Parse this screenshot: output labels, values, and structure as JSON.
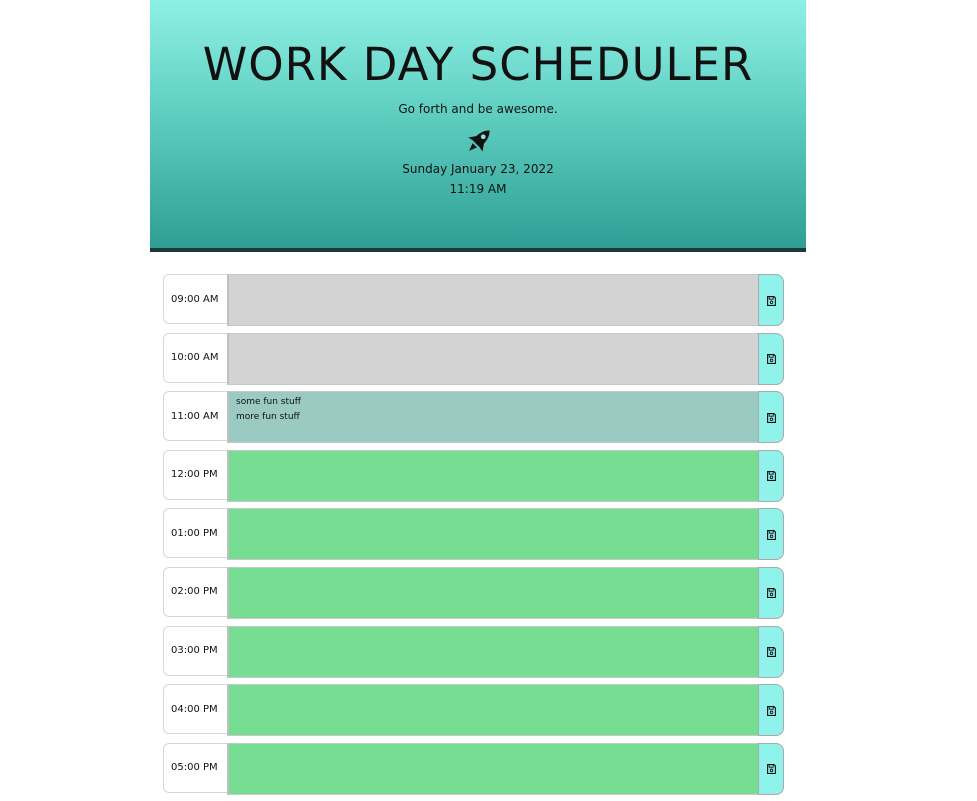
{
  "header": {
    "title": "WORK DAY SCHEDULER",
    "lead": "Go forth and be awesome.",
    "icon": "rocket-icon",
    "current_date": "Sunday January 23, 2022",
    "current_time": "11:19 AM"
  },
  "colors": {
    "past": "#d3d3d3",
    "present": "#9acac2",
    "future": "#77dd92",
    "save_button": "#8ff3ec",
    "header_top": "#8ff0e4",
    "header_bottom": "#2f9f95"
  },
  "schedule": [
    {
      "hour": "09:00 AM",
      "text": "",
      "state": "past"
    },
    {
      "hour": "10:00 AM",
      "text": "",
      "state": "past"
    },
    {
      "hour": "11:00 AM",
      "text": "some fun stuff\nmore fun stuff",
      "state": "present"
    },
    {
      "hour": "12:00 PM",
      "text": "",
      "state": "future"
    },
    {
      "hour": "01:00 PM",
      "text": "",
      "state": "future"
    },
    {
      "hour": "02:00 PM",
      "text": "",
      "state": "future"
    },
    {
      "hour": "03:00 PM",
      "text": "",
      "state": "future"
    },
    {
      "hour": "04:00 PM",
      "text": "",
      "state": "future"
    },
    {
      "hour": "05:00 PM",
      "text": "",
      "state": "future"
    }
  ],
  "save_icon": "save-icon"
}
